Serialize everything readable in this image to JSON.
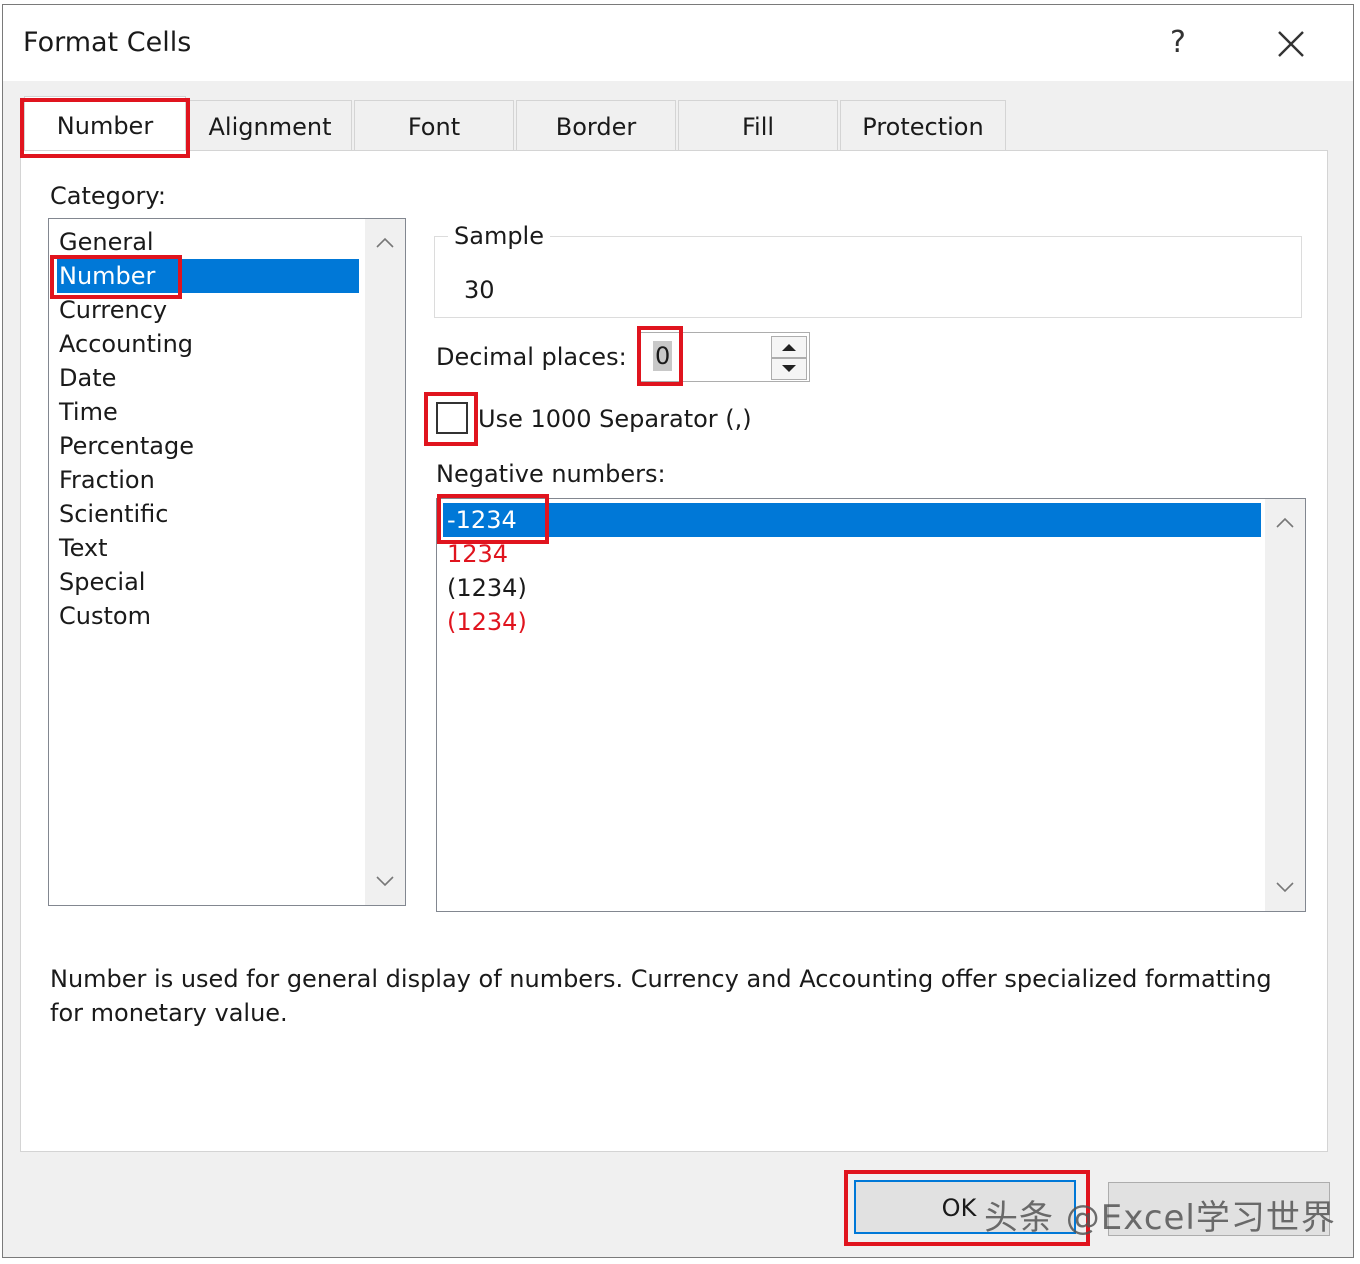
{
  "window": {
    "title": "Format Cells",
    "help_label": "?"
  },
  "tabs": [
    {
      "label": "Number",
      "active": true
    },
    {
      "label": "Alignment"
    },
    {
      "label": "Font"
    },
    {
      "label": "Border"
    },
    {
      "label": "Fill"
    },
    {
      "label": "Protection"
    }
  ],
  "category": {
    "label": "Category:",
    "items": [
      "General",
      "Number",
      "Currency",
      "Accounting",
      "Date",
      "Time",
      "Percentage",
      "Fraction",
      "Scientific",
      "Text",
      "Special",
      "Custom"
    ],
    "selected": "Number"
  },
  "sample": {
    "label": "Sample",
    "value": "30"
  },
  "decimal_places": {
    "label": "Decimal places:",
    "value": "0"
  },
  "separator": {
    "label": "Use 1000 Separator (,)",
    "checked": false
  },
  "negative_numbers": {
    "label": "Negative numbers:",
    "items": [
      {
        "text": "-1234",
        "color": "#000000"
      },
      {
        "text": "1234",
        "color": "#e0141e"
      },
      {
        "text": "(1234)",
        "color": "#000000"
      },
      {
        "text": "(1234)",
        "color": "#e0141e"
      }
    ],
    "selected": "-1234"
  },
  "description": "Number is used for general display of numbers.  Currency and Accounting offer specialized formatting for monetary value.",
  "buttons": {
    "ok": "OK",
    "cancel": ""
  },
  "watermark": "头条 @Excel学习世界",
  "colors": {
    "selection": "#0078d7",
    "highlight": "#e0141e",
    "negative_red": "#e0141e"
  }
}
